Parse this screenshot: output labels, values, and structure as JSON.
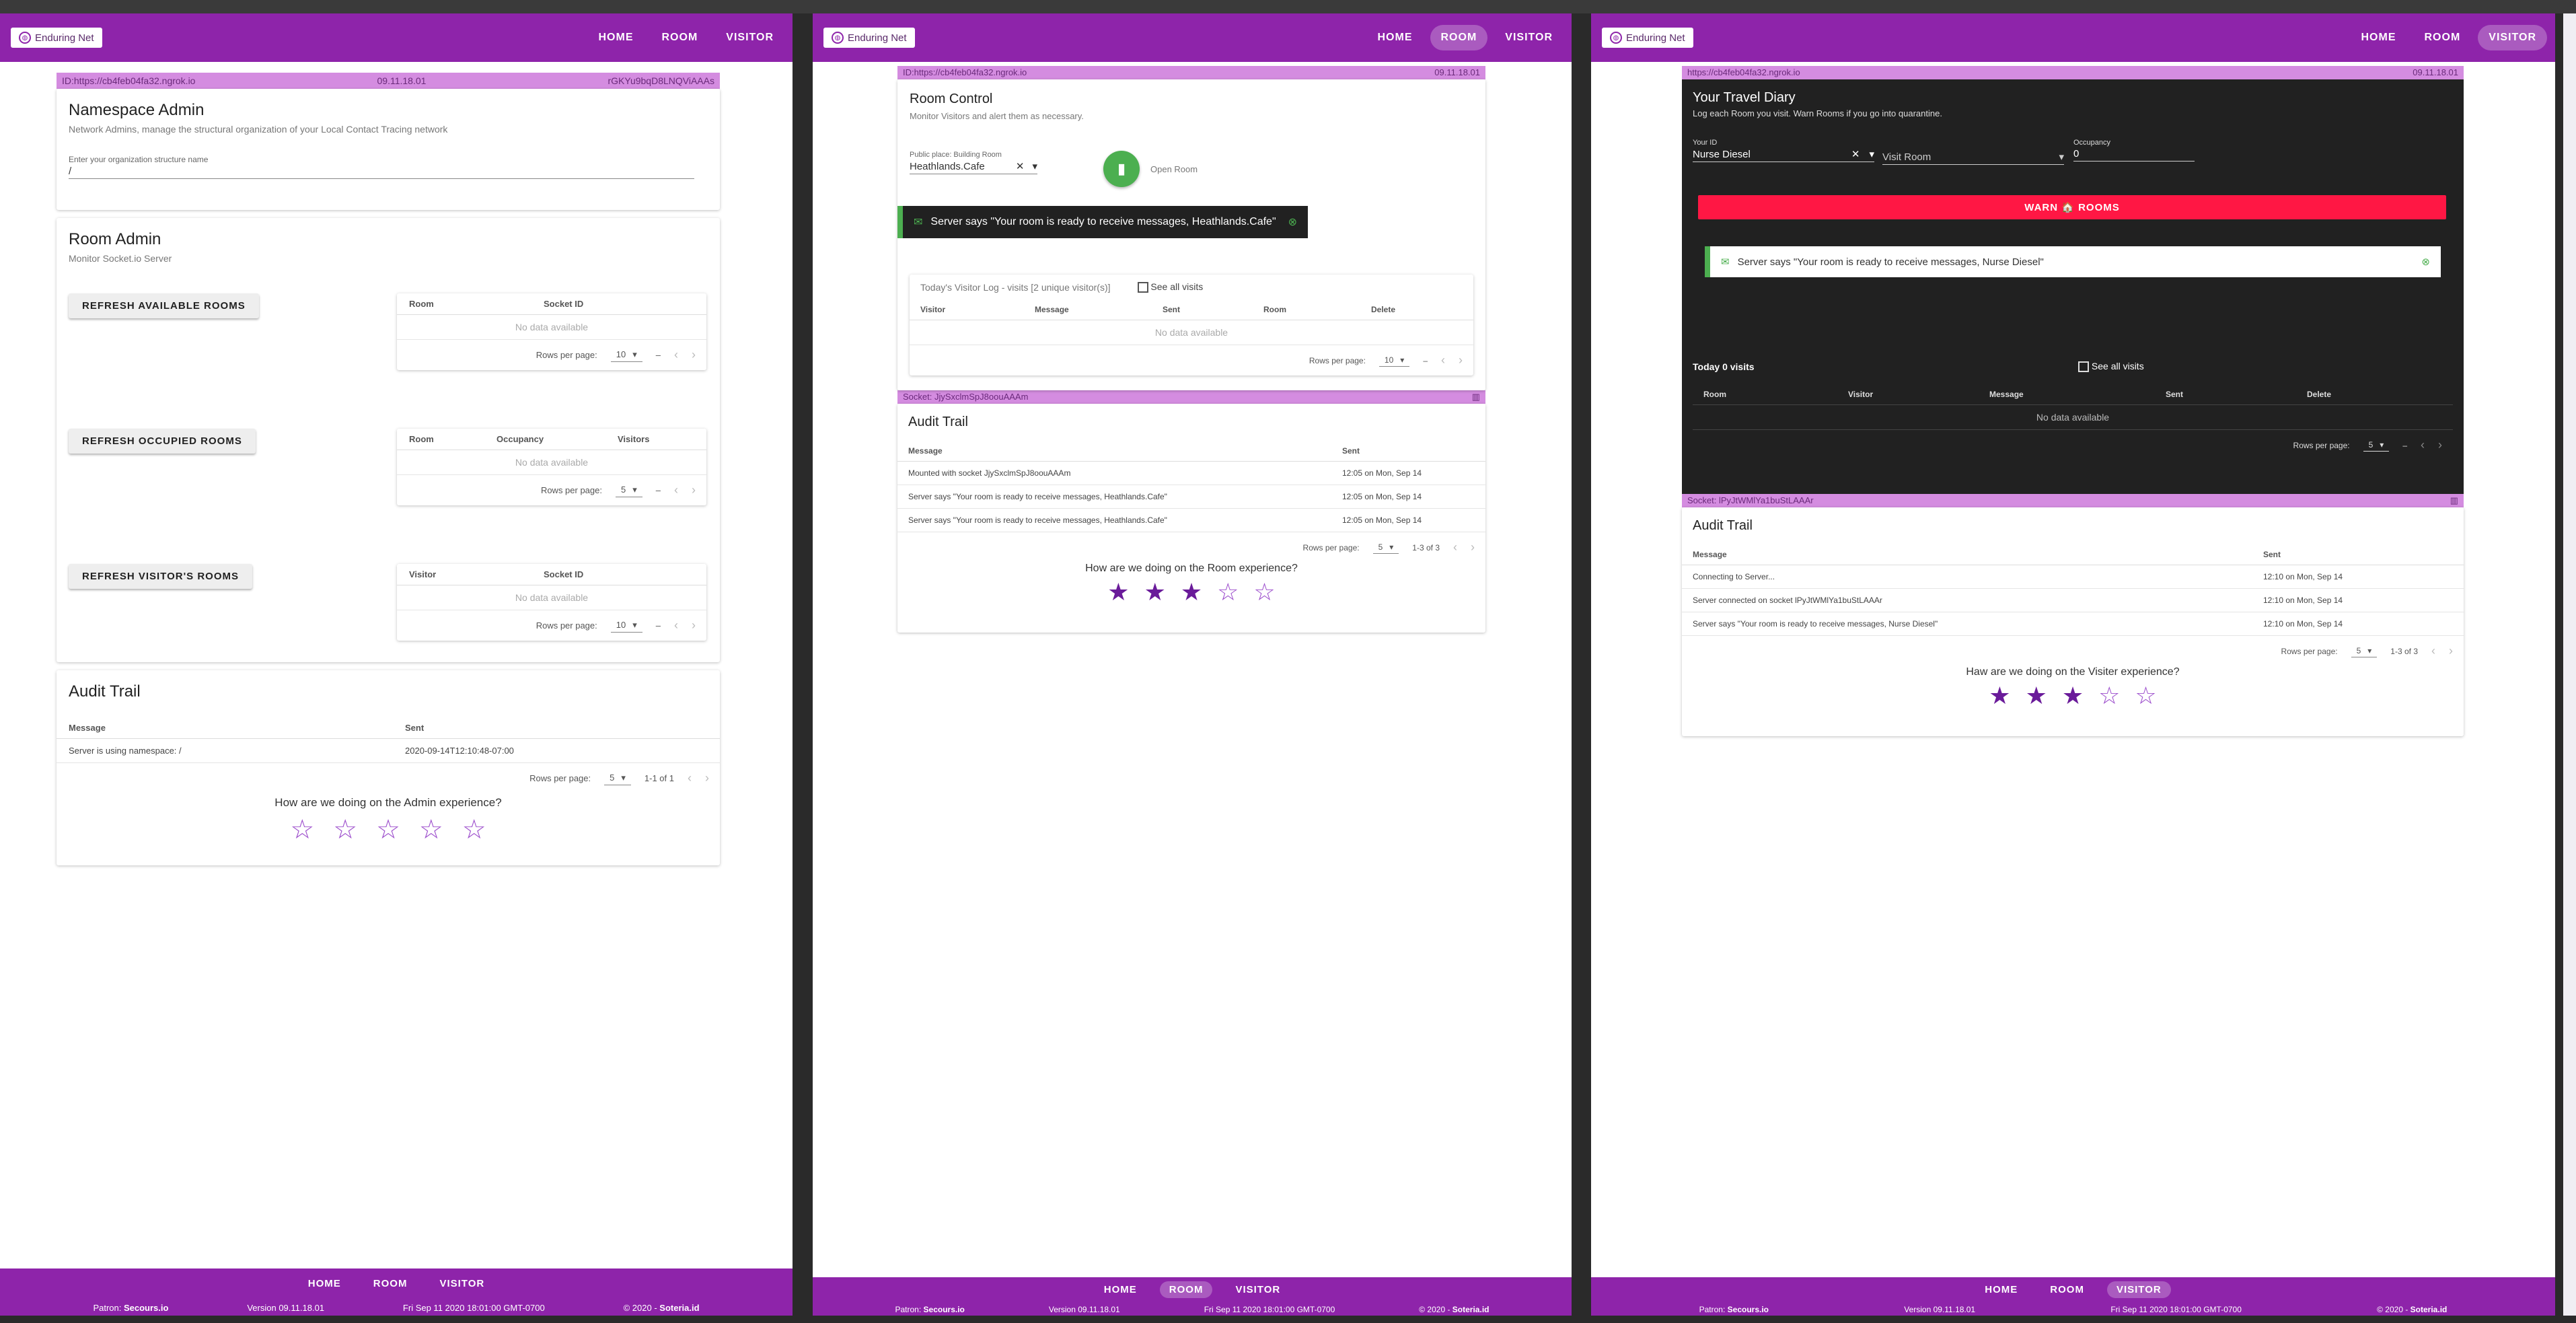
{
  "brand": "Enduring Net",
  "nav": {
    "home": "HOME",
    "room": "ROOM",
    "visitor": "VISITOR"
  },
  "footer": {
    "patron_label": "Patron:",
    "patron": "Secours.io",
    "version": "Version 09.11.18.01",
    "date": "Fri Sep 11 2020 18:01:00 GMT-0700",
    "copyright_label": "© 2020 -",
    "copyright": "Soteria.id"
  },
  "admin": {
    "idbar": {
      "left": "ID:https://cb4feb04fa32.ngrok.io",
      "center": "09.11.18.01",
      "right": "rGKYu9bqD8LNQViAAAs"
    },
    "namespace": {
      "title": "Namespace Admin",
      "subtitle": "Network Admins, manage the structural organization of your Local Contact Tracing network",
      "field_label": "Enter your organization structure name",
      "field_value": "/"
    },
    "room_admin": {
      "title": "Room Admin",
      "subtitle": "Monitor Socket.io Server"
    },
    "available": {
      "button": "REFRESH AVAILABLE ROOMS",
      "headers": [
        "Room",
        "Socket ID"
      ],
      "nodata": "No data available",
      "rows_label": "Rows per page:",
      "rows_value": "10",
      "range": "–"
    },
    "occupied": {
      "button": "REFRESH OCCUPIED ROOMS",
      "headers": [
        "Room",
        "Occupancy",
        "Visitors"
      ],
      "nodata": "No data available",
      "rows_label": "Rows per page:",
      "rows_value": "5",
      "range": "–"
    },
    "visitors": {
      "button": "REFRESH VISITOR'S ROOMS",
      "headers": [
        "Visitor",
        "Socket ID"
      ],
      "nodata": "No data available",
      "rows_label": "Rows per page:",
      "rows_value": "10",
      "range": "–"
    },
    "audit": {
      "title": "Audit Trail",
      "headers": [
        "Message",
        "Sent"
      ],
      "rows": [
        {
          "message": "Server is using namespace: /",
          "sent": "2020-09-14T12:10:48-07:00"
        }
      ],
      "rows_label": "Rows per page:",
      "rows_value": "5",
      "range": "1-1 of 1"
    },
    "rating": {
      "question": "How are we doing on the Admin experience?",
      "value": 0,
      "max": 5
    }
  },
  "room": {
    "idbar": {
      "left": "ID:https://cb4feb04fa32.ngrok.io",
      "right": "09.11.18.01"
    },
    "control": {
      "title": "Room Control",
      "subtitle": "Monitor Visitors and alert them as necessary.",
      "select_label": "Public place: Building Room",
      "select_value": "Heathlands.Cafe",
      "open_label": "Open Room"
    },
    "snackbar": "Server says \"Your room is ready to receive messages, Heathlands.Cafe\"",
    "log": {
      "title": "Today's Visitor Log - visits [2 unique visitor(s)]",
      "see_all": "See all visits",
      "headers": [
        "Visitor",
        "Message",
        "Sent",
        "Room",
        "Delete"
      ],
      "nodata": "No data available",
      "rows_label": "Rows per page:",
      "rows_value": "10",
      "range": "–"
    },
    "socketbar": "Socket: JjySxclmSpJ8oouAAAm",
    "audit": {
      "title": "Audit Trail",
      "headers": [
        "Message",
        "Sent"
      ],
      "rows": [
        {
          "message": "Mounted with socket JjySxclmSpJ8oouAAAm",
          "sent": "12:05 on Mon, Sep 14"
        },
        {
          "message": "Server says \"Your room is ready to receive messages, Heathlands.Cafe\"",
          "sent": "12:05 on Mon, Sep 14"
        },
        {
          "message": "Server says \"Your room is ready to receive messages, Heathlands.Cafe\"",
          "sent": "12:05 on Mon, Sep 14"
        }
      ],
      "rows_label": "Rows per page:",
      "rows_value": "5",
      "range": "1-3 of 3"
    },
    "rating": {
      "question": "How are we doing on the Room experience?",
      "value": 3,
      "max": 5
    }
  },
  "visitor": {
    "idbar": {
      "left": "https://cb4feb04fa32.ngrok.io",
      "right": "09.11.18.01"
    },
    "diary": {
      "title": "Your Travel Diary",
      "subtitle": "Log each Room you visit. Warn Rooms if you go into quarantine.",
      "id_label": "Your ID",
      "id_value": "Nurse Diesel",
      "visit_placeholder": "Visit Room",
      "occ_label": "Occupancy",
      "occ_value": "0",
      "warn": "WARN 🏠 ROOMS"
    },
    "snackbar": "Server says \"Your room is ready to receive messages, Nurse Diesel\"",
    "visits": {
      "title": "Today 0 visits",
      "see_all": "See all visits",
      "headers": [
        "Room",
        "Visitor",
        "Message",
        "Sent",
        "Delete"
      ],
      "nodata": "No data available",
      "rows_label": "Rows per page:",
      "rows_value": "5",
      "range": "–"
    },
    "socketbar": "Socket: lPyJtWMlYa1buStLAAAr",
    "audit": {
      "title": "Audit Trail",
      "headers": [
        "Message",
        "Sent"
      ],
      "rows": [
        {
          "message": "Connecting to Server...",
          "sent": "12:10 on Mon, Sep 14"
        },
        {
          "message": "Server connected on socket lPyJtWMlYa1buStLAAAr",
          "sent": "12:10 on Mon, Sep 14"
        },
        {
          "message": "Server says \"Your room is ready to receive messages, Nurse Diesel\"",
          "sent": "12:10 on Mon, Sep 14"
        }
      ],
      "rows_label": "Rows per page:",
      "rows_value": "5",
      "range": "1-3 of 3"
    },
    "rating": {
      "question": "Haw are we doing on the Visiter experience?",
      "value": 3,
      "max": 5
    }
  },
  "colors": {
    "primary": "#8e24aa",
    "idbar": "#d48ce0",
    "success": "#4caf50",
    "warn": "#ff1744",
    "dark": "#212121"
  }
}
